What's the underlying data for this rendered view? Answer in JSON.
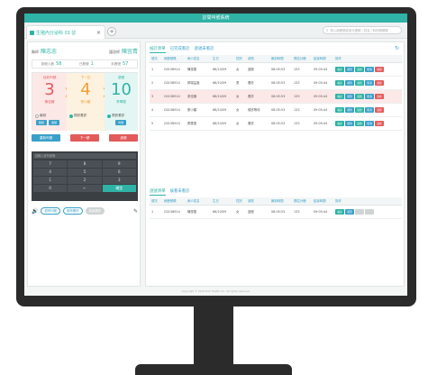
{
  "app": {
    "title": "診間叫號系統"
  },
  "tab": {
    "label": "生殖內分泌科 01 診",
    "close": "×",
    "add": "+"
  },
  "search": {
    "placeholder": "請入病歷號或身分證號 / 姓名 / 科別號碼號"
  },
  "doctor": {
    "doctor_label": "醫師",
    "doctor_name": "陳志忠",
    "nurse_label": "護理師",
    "nurse_name": "陳宜青"
  },
  "stats": [
    {
      "label": "掛號人數",
      "value": "58"
    },
    {
      "label": "已看號",
      "value": "1"
    },
    {
      "label": "未看號",
      "value": "57"
    }
  ],
  "flow": {
    "current": {
      "header": "目前叫號",
      "number": "3",
      "name": "黃佳臻"
    },
    "next": {
      "header": "下一位",
      "number": "4",
      "name": "蔡小穎"
    },
    "pass": {
      "header": "過號",
      "number": "10",
      "name": "李翠蘭"
    },
    "check1": "報到",
    "check2": "視訊看診",
    "check3": "視訊看診",
    "mini": [
      "確認",
      "過號",
      "叫號"
    ]
  },
  "actions": {
    "recall": "重新叫號",
    "next": "下一號",
    "pass": "過號"
  },
  "keypad": {
    "placeholder": "請輸入欲叫號碼",
    "keys": [
      "7",
      "8",
      "9",
      "4",
      "5",
      "6",
      "1",
      "2",
      "3",
      "0",
      "←",
      "確定"
    ]
  },
  "bottom": {
    "pause": "暫停叫號",
    "stop": "暫停看診",
    "end": "結束看診"
  },
  "subtabs1": [
    "候診清單",
    "已完成看診",
    "過號未看診"
  ],
  "subtabs2": [
    "過號清單",
    "候看未看診"
  ],
  "columns": [
    "號次",
    "病歷號碼",
    "病人姓名",
    "生日",
    "性別",
    "狀態",
    "報到時間",
    "預估分鐘",
    "結束時間",
    "操作"
  ],
  "rows": [
    {
      "no": "1",
      "id": "G0158914",
      "name": "陳惠蘭",
      "birth": "68/10/09",
      "sex": "女",
      "status": "過號",
      "checkin": "08:05:53",
      "est": "133",
      "end": "09:05:44"
    },
    {
      "no": "2",
      "id": "G0158914",
      "name": "鄭瑞益鑫",
      "birth": "68/10/09",
      "sex": "男",
      "status": "看診",
      "checkin": "08:05:53",
      "est": "133",
      "end": "09:05:44"
    },
    {
      "no": "3",
      "id": "G0158914",
      "name": "黃佳臻",
      "birth": "68/10/09",
      "sex": "女",
      "status": "看診",
      "checkin": "08:05:53",
      "est": "133",
      "end": "09:05:44"
    },
    {
      "no": "4",
      "id": "G0158914",
      "name": "蔡小穎",
      "birth": "68/10/09",
      "sex": "女",
      "status": "候診等待",
      "checkin": "08:05:53",
      "est": "133",
      "end": "09:05:44"
    },
    {
      "no": "5",
      "id": "G0158914",
      "name": "蔡蕙惠",
      "birth": "68/10/09",
      "sex": "女",
      "status": "看診",
      "checkin": "08:05:53",
      "est": "133",
      "end": "09:05:44"
    }
  ],
  "row_ops": [
    "看診",
    "報到",
    "過號",
    "取消",
    "退掛"
  ],
  "pass_rows": [
    {
      "no": "1",
      "id": "G0158914",
      "name": "陳惠蘭",
      "birth": "68/10/09",
      "sex": "女",
      "status": "過號",
      "checkin": "08:05:53",
      "est": "133",
      "end": "09:05:44"
    }
  ],
  "pass_ops": [
    "看診",
    "報到"
  ],
  "footer": "Copyright © 2019 Tech Health Inc. All rights reserved.",
  "colors": {
    "teal": "#2fb3a6",
    "blue": "#3aa0c9",
    "red": "#e25a5a",
    "amber": "#f0a030",
    "bezel": "#2b2b2b"
  }
}
